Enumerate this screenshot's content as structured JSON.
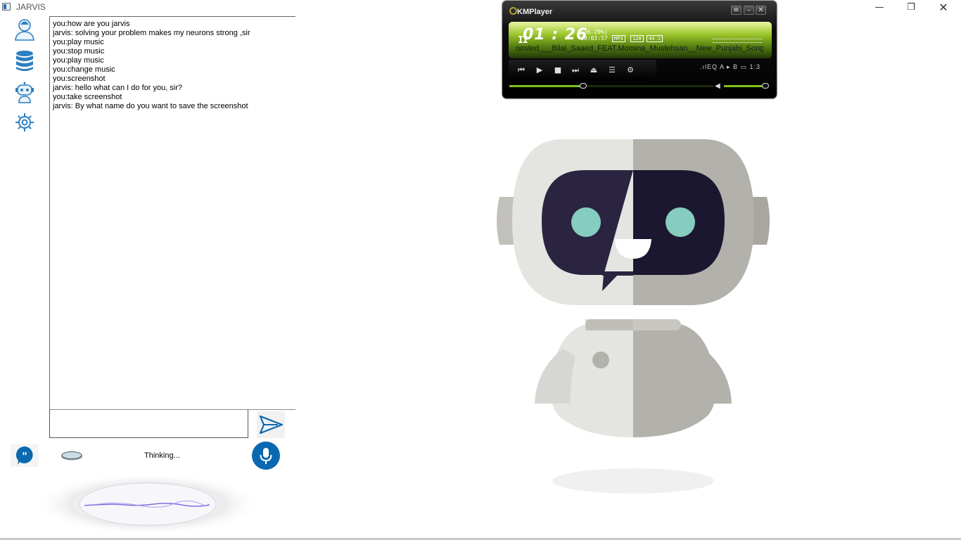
{
  "window": {
    "title": "JARVIS",
    "minimize_glyph": "—",
    "maximize_glyph": "❐",
    "close_glyph": "✕"
  },
  "sidebar": {
    "items": [
      {
        "icon": "user-profile-icon"
      },
      {
        "icon": "database-icon"
      },
      {
        "icon": "robot-icon"
      },
      {
        "icon": "gear-icon"
      }
    ]
  },
  "chat": {
    "lines": [
      "you:how are you jarvis",
      "jarvis: solving your problem makes my neurons strong ,sir",
      "you:play music",
      "you:stop music",
      "you:play music",
      "you:change music",
      "you:screenshot",
      "jarvis: hello what can I do for you, sir?",
      "you:take screenshot",
      "jarvis: By what name do you want to save the screenshot"
    ],
    "input_value": ""
  },
  "status": {
    "text": "Thinking..."
  },
  "colors": {
    "accent": "#0a68b0",
    "km_green": "#7fc21a"
  },
  "kmplayer": {
    "title": "KMPlayer",
    "time": "01 : 26",
    "pause_glyph": "II",
    "percent": "(36.29%)",
    "total": "00:03:57",
    "format": "MP3",
    "bitrate": "128",
    "samplerate": "44.1",
    "song": "oosted___Bilal_Saaed_FEAT.Momina_Mustehsan__New_Punjabi_Song_ft",
    "extra": ".ılEQ  A ▸ B  ▭ 1:3",
    "seek_fraction": 0.3629,
    "volume_fraction": 0.95
  },
  "mascot": {
    "icon": "chatbot-mascot-illustration"
  }
}
